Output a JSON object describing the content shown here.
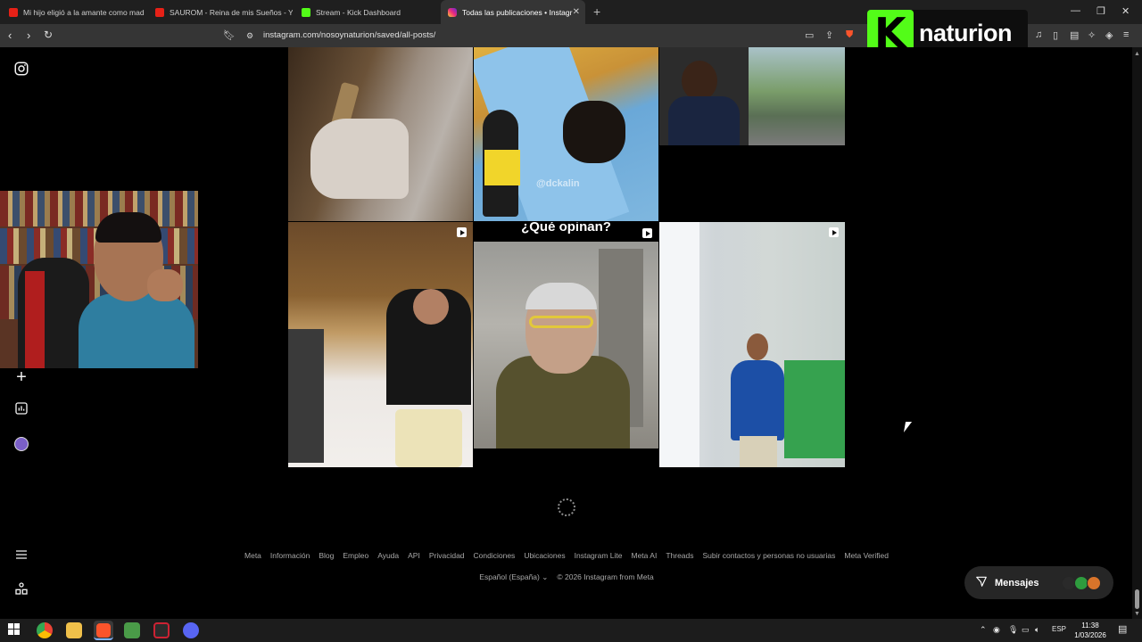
{
  "browser": {
    "tabs": [
      {
        "title": "Mi hijo eligió a la amante como mad",
        "favicon": "youtube-icon"
      },
      {
        "title": "SAUROM - Reina de mis Sueños - Yo",
        "favicon": "youtube-icon"
      },
      {
        "title": "Stream - Kick Dashboard",
        "favicon": "kick-icon"
      },
      {
        "title": "Todas las publicaciones • Instagr",
        "favicon": "instagram-icon",
        "active": true
      }
    ],
    "url": "instagram.com/nosoynaturion/saved/all-posts/",
    "colors": {
      "tabbar": "#1f1f1f",
      "toolbar": "#353535"
    }
  },
  "overlay": {
    "logo_letter": "K",
    "channel_name": "naturion",
    "brand_color": "#53fc18"
  },
  "instagram": {
    "sidebar_icons": [
      "instagram-icon",
      "heart-icon",
      "create-icon",
      "dashboard-icon",
      "profile-avatar-icon",
      "menu-icon",
      "apps-icon"
    ],
    "grid_post_labels": {
      "opinan_caption": "¿Qué opinan?",
      "watermark": "@dckalin"
    },
    "footer_links": [
      "Meta",
      "Información",
      "Blog",
      "Empleo",
      "Ayuda",
      "API",
      "Privacidad",
      "Condiciones",
      "Ubicaciones",
      "Instagram Lite",
      "Meta AI",
      "Threads",
      "Subir contactos y personas no usuarias",
      "Meta Verified"
    ],
    "language": "Español (España)",
    "copyright": "© 2026 Instagram from Meta",
    "messages_label": "Mensajes"
  },
  "taskbar": {
    "language": "ESP",
    "time": "11:38",
    "date": "1/03/2026"
  }
}
